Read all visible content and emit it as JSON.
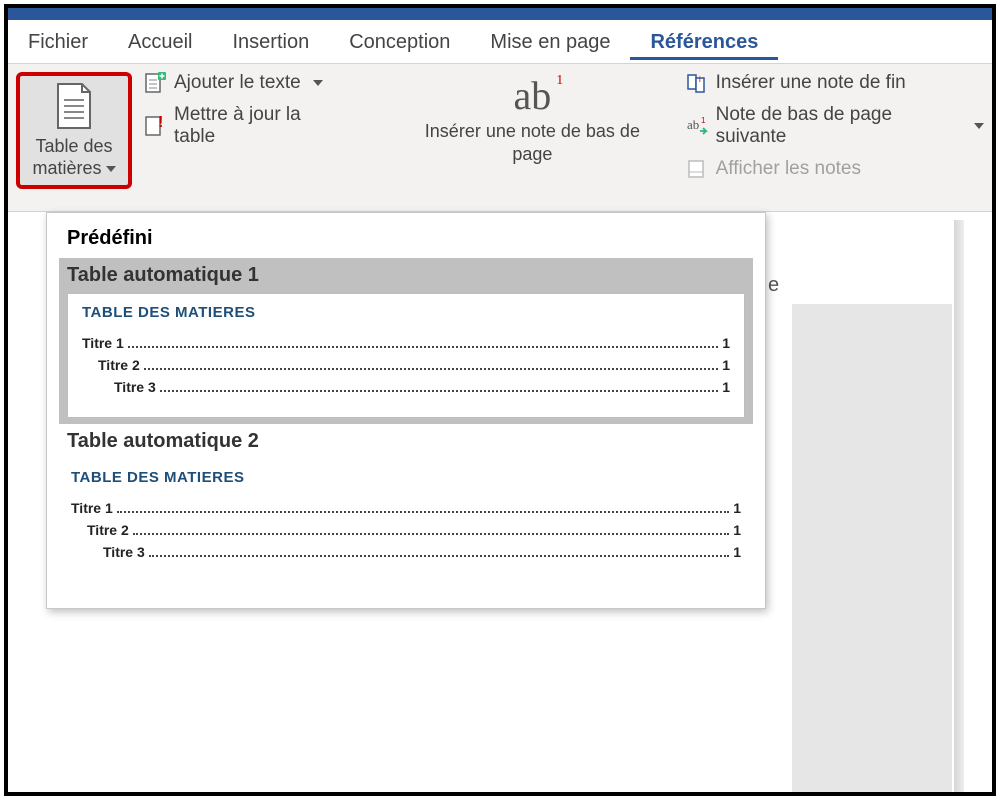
{
  "tabs": {
    "file": "Fichier",
    "home": "Accueil",
    "insert": "Insertion",
    "design": "Conception",
    "layout": "Mise en page",
    "references": "Références"
  },
  "ribbon": {
    "toc_button": "Table des matières",
    "add_text": "Ajouter le texte",
    "update_table": "Mettre à jour la table",
    "insert_footnote": "Insérer une note de bas de page",
    "insert_endnote": "Insérer une note de fin",
    "next_footnote": "Note de bas de page suivante",
    "show_notes": "Afficher les notes"
  },
  "gallery": {
    "predefined": "Prédéfini",
    "auto1": {
      "title": "Table automatique 1",
      "heading": "TABLE DES MATIERES",
      "rows": [
        {
          "label": "Titre 1",
          "page": "1",
          "indent": 0
        },
        {
          "label": "Titre 2",
          "page": "1",
          "indent": 1
        },
        {
          "label": "Titre 3",
          "page": "1",
          "indent": 2
        }
      ]
    },
    "auto2": {
      "title": "Table automatique 2",
      "heading": "TABLE DES MATIERES",
      "rows": [
        {
          "label": "Titre 1",
          "page": "1",
          "indent": 0
        },
        {
          "label": "Titre 2",
          "page": "1",
          "indent": 1
        },
        {
          "label": "Titre 3",
          "page": "1",
          "indent": 2
        }
      ]
    }
  },
  "peek": "e"
}
